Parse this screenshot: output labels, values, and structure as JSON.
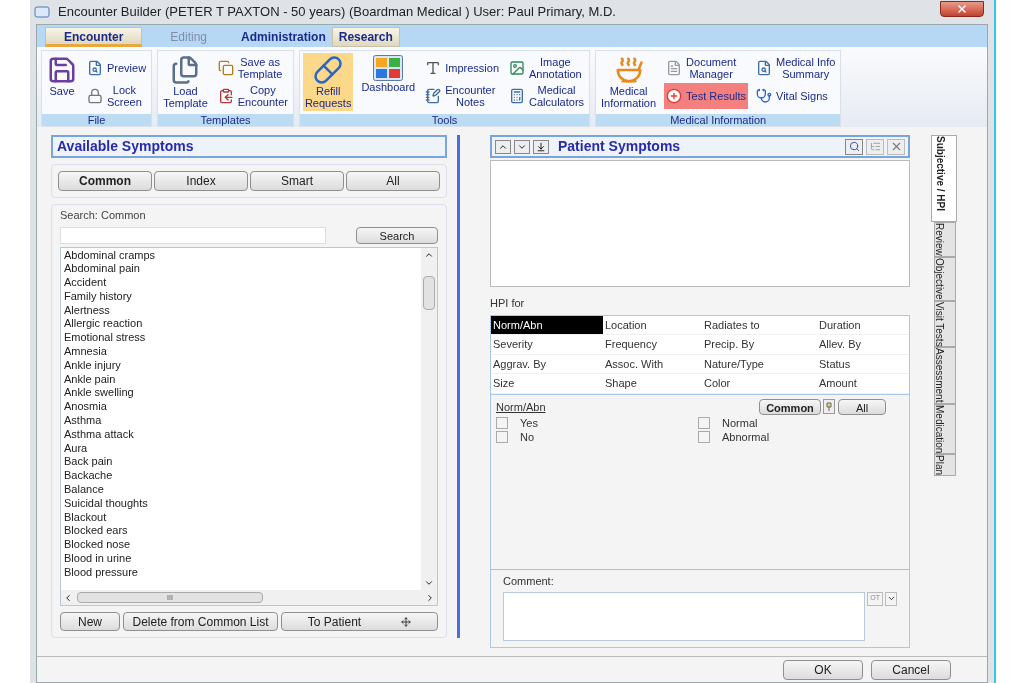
{
  "window": {
    "title": "Encounter Builder (PETER T PAXTON - 50 years) (Boardman Medical )  User: Paul Primary, M.D."
  },
  "menu_tabs": [
    {
      "label": "Encounter",
      "selected": true,
      "disabled": false,
      "raised": true
    },
    {
      "label": "Editing",
      "selected": false,
      "disabled": true,
      "raised": false
    },
    {
      "label": "Administration",
      "selected": false,
      "disabled": false,
      "raised": false
    },
    {
      "label": "Research",
      "selected": false,
      "disabled": false,
      "raised": true
    }
  ],
  "ribbon": [
    {
      "label": "File",
      "items": [
        {
          "kind": "large",
          "label": "Save"
        },
        {
          "kind": "column",
          "items": [
            {
              "label": "Preview"
            },
            {
              "label": "Lock\nScreen"
            }
          ]
        }
      ]
    },
    {
      "label": "Templates",
      "items": [
        {
          "kind": "large",
          "label": "Load\nTemplate"
        },
        {
          "kind": "column",
          "items": [
            {
              "label": "Save as\nTemplate"
            },
            {
              "label": "Copy\nEncounter"
            }
          ]
        }
      ]
    },
    {
      "label": "Tools",
      "items": [
        {
          "kind": "large",
          "label": "Refill\nRequests",
          "color": "#fcd88a"
        },
        {
          "kind": "large",
          "label": "Dashboard"
        },
        {
          "kind": "column",
          "items": [
            {
              "label": "Impression"
            },
            {
              "label": "Encounter\nNotes"
            }
          ]
        },
        {
          "kind": "column",
          "items": [
            {
              "label": "Image\nAnnotation"
            },
            {
              "label": "Medical\nCalculators"
            }
          ]
        }
      ]
    },
    {
      "label": "Medical Information",
      "items": [
        {
          "kind": "large",
          "label": "Medical\nInformation"
        },
        {
          "kind": "column",
          "items": [
            {
              "label": "Document\nManager"
            },
            {
              "label": "Test Results",
              "color": "#f47f7f"
            }
          ]
        },
        {
          "kind": "column",
          "items": [
            {
              "label": "Medical Info\nSummary"
            },
            {
              "label": "Vital Signs"
            }
          ]
        }
      ]
    }
  ],
  "available_symptoms": {
    "title": "Available Symptoms",
    "filters": [
      {
        "label": "Common",
        "selected": true
      },
      {
        "label": "Index",
        "selected": false
      },
      {
        "label": "Smart",
        "selected": false
      },
      {
        "label": "All",
        "selected": false
      }
    ],
    "search_label": "Search: Common",
    "search_button": "Search",
    "items": [
      "Abdominal cramps",
      "Abdominal pain",
      "Accident",
      "Family history",
      "Alertness",
      "Allergic reaction",
      "Emotional stress",
      "Amnesia",
      "Ankle injury",
      "Ankle pain",
      "Ankle swelling",
      "Anosmia",
      "Asthma",
      "Asthma attack",
      "Aura",
      "Back pain",
      "Backache",
      "Balance",
      "Suicidal thoughts",
      "Blackout",
      "Blocked ears",
      "Blocked nose",
      "Blood in urine",
      "Blood pressure"
    ],
    "scroll_grip": "III",
    "buttons": [
      "New",
      "Delete from Common List",
      "To Patient"
    ]
  },
  "patient_symptoms": {
    "title": "Patient Symptoms",
    "hpi_label": "HPI for",
    "hpi_grid": [
      [
        {
          "label": "Norm/Abn",
          "selected": true
        },
        {
          "label": "Location",
          "selected": false
        },
        {
          "label": "Radiates to",
          "selected": false
        },
        {
          "label": "Duration",
          "selected": false
        }
      ],
      [
        {
          "label": "Severity",
          "selected": false
        },
        {
          "label": "Frequency",
          "selected": false
        },
        {
          "label": "Precip. By",
          "selected": false
        },
        {
          "label": "Allev. By",
          "selected": false
        }
      ],
      [
        {
          "label": "Aggrav. By",
          "selected": false
        },
        {
          "label": "Assoc. With",
          "selected": false
        },
        {
          "label": "Nature/Type",
          "selected": false
        },
        {
          "label": "Status",
          "selected": false
        }
      ],
      [
        {
          "label": "Size",
          "selected": false
        },
        {
          "label": "Shape",
          "selected": false
        },
        {
          "label": "Color",
          "selected": false
        },
        {
          "label": "Amount",
          "selected": false
        }
      ]
    ],
    "detail_title": "Norm/Abn",
    "detail_filters": [
      {
        "label": "Common",
        "selected": true
      },
      {
        "label": "All",
        "selected": false
      }
    ],
    "options": [
      [
        {
          "label": "Yes",
          "checked": false
        },
        {
          "label": "No",
          "checked": false
        }
      ],
      [
        {
          "label": "Normal",
          "checked": false
        },
        {
          "label": "Abnormal",
          "checked": false
        }
      ]
    ],
    "comment_label": "Comment:",
    "comment_tool": "OT"
  },
  "side_tabs": [
    {
      "label": "Subjective / HPI",
      "selected": true
    },
    {
      "label": "Review",
      "selected": false
    },
    {
      "label": "Objective",
      "selected": false
    },
    {
      "label": "Visit Tests",
      "selected": false
    },
    {
      "label": "Assessment",
      "selected": false
    },
    {
      "label": "Medication",
      "selected": false
    },
    {
      "label": "Plan",
      "selected": false
    }
  ],
  "dialog_buttons": [
    "OK",
    "Cancel"
  ]
}
